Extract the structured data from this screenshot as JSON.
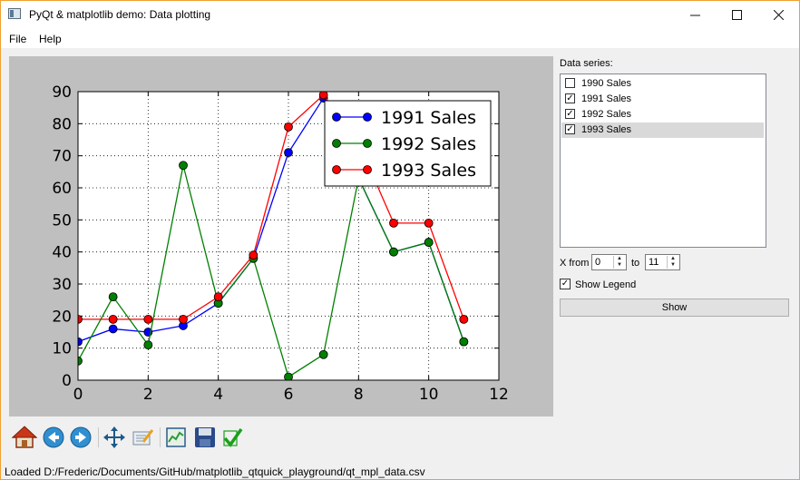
{
  "window": {
    "title": "PyQt & matplotlib demo: Data plotting",
    "min_icon": "minimize-icon",
    "max_icon": "maximize-icon",
    "close_icon": "close-icon"
  },
  "menu": [
    "File",
    "Help"
  ],
  "panel": {
    "series_label": "Data series:",
    "series": [
      {
        "label": "1990 Sales",
        "checked": false,
        "selected": false
      },
      {
        "label": "1991 Sales",
        "checked": true,
        "selected": false
      },
      {
        "label": "1992 Sales",
        "checked": true,
        "selected": false
      },
      {
        "label": "1993 Sales",
        "checked": true,
        "selected": true
      }
    ],
    "x_from_label": "X from",
    "x_from_value": "0",
    "to_label": "to",
    "x_to_value": "11",
    "show_legend_label": "Show Legend",
    "show_legend_checked": true,
    "show_button": "Show"
  },
  "toolbar": [
    "home-icon",
    "back-icon",
    "forward-icon",
    "pan-icon",
    "zoom-rect-icon",
    "subplots-icon",
    "save-icon",
    "apply-check-icon"
  ],
  "status": "Loaded D:/Frederic/Documents/GitHub/matplotlib_qtquick_playground/qt_mpl_data.csv",
  "chart_data": {
    "type": "line",
    "title": "",
    "xlabel": "",
    "ylabel": "",
    "xlim": [
      0,
      12
    ],
    "ylim": [
      0,
      90
    ],
    "xticks": [
      0,
      2,
      4,
      6,
      8,
      10,
      12
    ],
    "yticks": [
      0,
      10,
      20,
      30,
      40,
      50,
      60,
      70,
      80,
      90
    ],
    "grid": true,
    "legend": "top-right",
    "x": [
      0,
      1,
      2,
      3,
      4,
      5,
      6,
      7,
      8,
      9,
      10,
      11
    ],
    "series": [
      {
        "name": "1991 Sales",
        "color": "#0000ff",
        "values": [
          12,
          16,
          15,
          17,
          24,
          38,
          71,
          88,
          63,
          40,
          43,
          12
        ]
      },
      {
        "name": "1992 Sales",
        "color": "#008000",
        "values": [
          6,
          26,
          11,
          67,
          24,
          38,
          1,
          8,
          63,
          40,
          43,
          12
        ]
      },
      {
        "name": "1993 Sales",
        "color": "#ff0000",
        "values": [
          19,
          19,
          19,
          19,
          26,
          39,
          79,
          89,
          74,
          49,
          49,
          19
        ]
      }
    ]
  }
}
